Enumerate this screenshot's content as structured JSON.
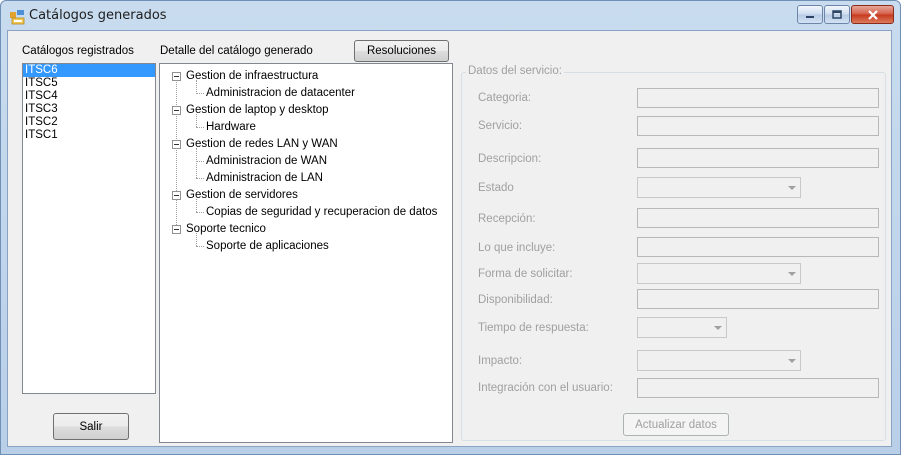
{
  "window": {
    "title": "Catálogos generados",
    "icon": "app-form-icon",
    "accent_color": "#3399ff"
  },
  "left": {
    "label": "Catálogos registrados",
    "items": [
      "ITSC6",
      "ITSC5",
      "ITSC4",
      "ITSC3",
      "ITSC2",
      "ITSC1"
    ],
    "selected": "ITSC6",
    "exit_button": "Salir"
  },
  "middle": {
    "label": "Detalle del catálogo generado",
    "resolutions_button": "Resoluciones",
    "tree": [
      {
        "label": "Gestion de infraestructura",
        "children": [
          "Administracion de datacenter"
        ]
      },
      {
        "label": "Gestion de laptop y desktop",
        "children": [
          "Hardware"
        ]
      },
      {
        "label": "Gestion de redes LAN y WAN",
        "children": [
          "Administracion de WAN",
          "Administracion de LAN"
        ]
      },
      {
        "label": "Gestion de servidores",
        "children": [
          "Copias de seguridad y recuperacion de datos"
        ]
      },
      {
        "label": "Soporte tecnico",
        "children": [
          "Soporte de aplicaciones"
        ]
      }
    ]
  },
  "service": {
    "group_title": "Datos del servicio:",
    "fields": {
      "categoria": {
        "label": "Categoria:",
        "value": ""
      },
      "servicio": {
        "label": "Servicio:",
        "value": ""
      },
      "descripcion": {
        "label": "Descripcion:",
        "value": ""
      },
      "estado": {
        "label": "Estado",
        "value": ""
      },
      "recepcion": {
        "label": "Recepción:",
        "value": ""
      },
      "incluye": {
        "label": "Lo que incluye:",
        "value": ""
      },
      "forma": {
        "label": "Forma de solicitar:",
        "value": ""
      },
      "disponibilidad": {
        "label": "Disponibilidad:",
        "value": ""
      },
      "tiempo": {
        "label": "Tiempo de respuesta:",
        "value": ""
      },
      "impacto": {
        "label": "Impacto:",
        "value": ""
      },
      "integracion": {
        "label": "Integración con el usuario:",
        "value": ""
      }
    },
    "update_button": "Actualizar datos"
  }
}
